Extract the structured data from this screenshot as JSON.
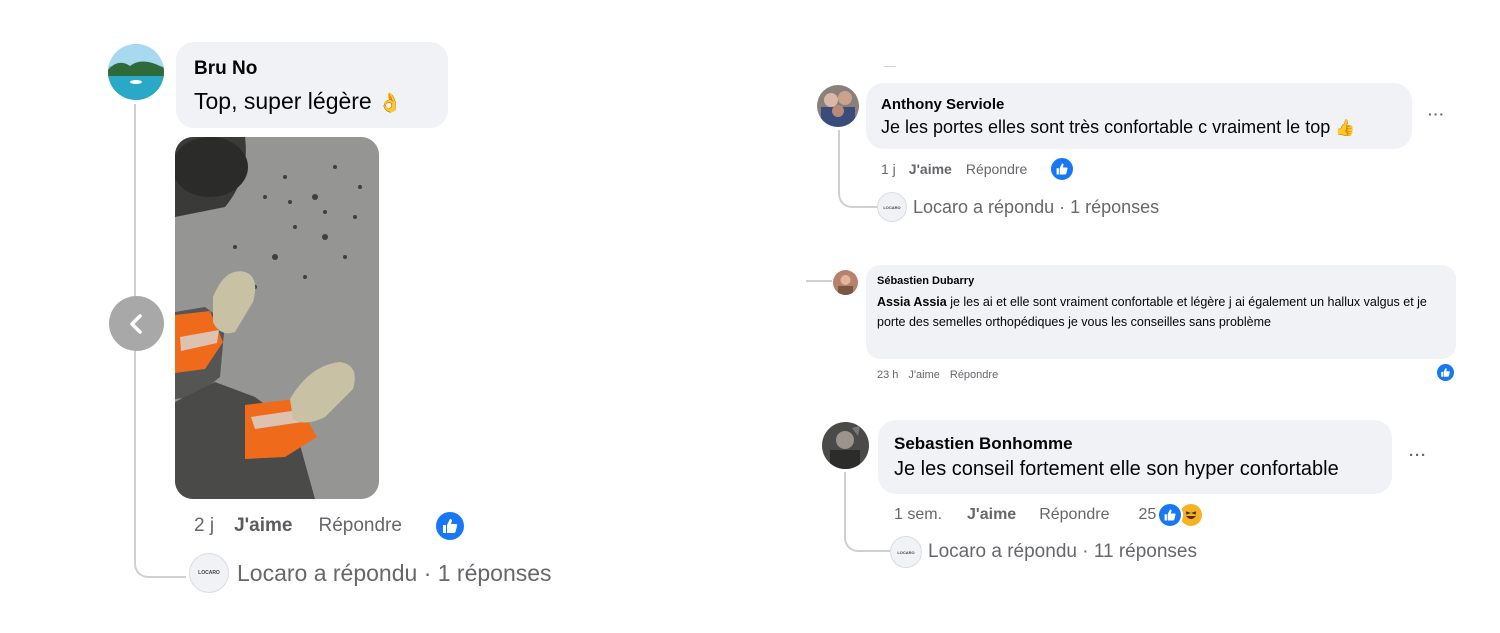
{
  "colors": {
    "bubble": "#f0f2f5",
    "like_blue": "#1877f2",
    "secondary_text": "#65676b",
    "thread_line": "#ced0d4"
  },
  "left_comment": {
    "author": "Bru No",
    "text": "Top, super légère",
    "emoji": "👌",
    "photo_icon": "photo-boots-image",
    "actions": {
      "time": "2 j",
      "like": "J'aime",
      "reply": "Répondre"
    },
    "reaction_icon": "like-icon",
    "reply_summary": {
      "logo_text": "LOCARO",
      "text": "Locaro a répondu · 1 réponses"
    },
    "carousel_icon": "chevron-left-icon"
  },
  "right_comments": [
    {
      "author": "Anthony Serviole",
      "text": "Je les portes elles sont très confortable c vraiment le top",
      "emoji": "👍",
      "actions": {
        "time": "1 j",
        "like": "J'aime",
        "reply": "Répondre"
      },
      "reply_summary": {
        "logo_text": "LOCARO",
        "text": "Locaro a répondu · 1 réponses"
      },
      "more": "···"
    },
    {
      "author": "Sébastien Dubarry",
      "mention": "Assia Assia",
      "text": " je les ai et elle sont vraiment confortable et légère j ai également un hallux valgus et je porte des semelles orthopédiques je vous les conseilles sans problème",
      "actions": {
        "time": "23 h",
        "like": "J'aime",
        "reply": "Répondre"
      }
    },
    {
      "author": "Sebastien Bonhomme",
      "text": "Je les conseil fortement elle son hyper confortable",
      "actions": {
        "time": "1 sem.",
        "like": "J'aime",
        "reply": "Répondre",
        "reaction_count": "25"
      },
      "reply_summary": {
        "logo_text": "LOCARO",
        "text": "Locaro a répondu · 11 réponses"
      },
      "more": "···"
    }
  ]
}
